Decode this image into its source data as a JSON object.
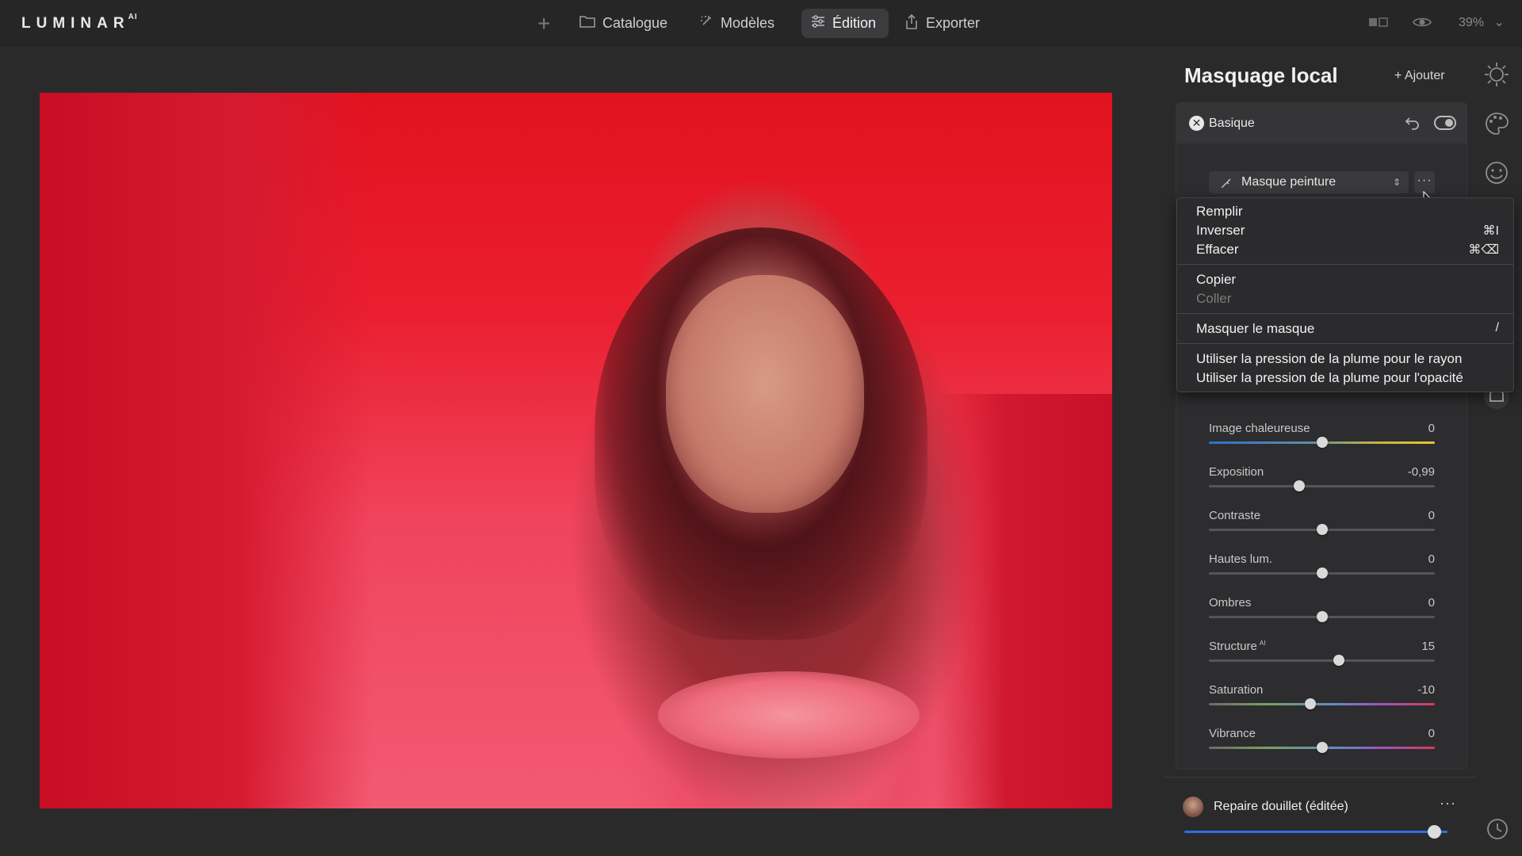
{
  "app": {
    "logo_text": "LUMINAR",
    "logo_suffix": "AI",
    "nav": [
      {
        "label": "Catalogue",
        "icon": "folder-icon"
      },
      {
        "label": "Modèles",
        "icon": "sparkle-icon"
      },
      {
        "label": "Édition",
        "icon": "sliders-icon",
        "active": true
      },
      {
        "label": "Exporter",
        "icon": "share-icon"
      }
    ],
    "add_label": "+",
    "zoom": "39%"
  },
  "panel": {
    "title": "Masquage local",
    "add_label": "+ Ajouter",
    "tool": {
      "name": "Basique",
      "close_glyph": "✕",
      "mask_mode": "Masque peinture",
      "more_glyph": "···"
    },
    "menu": {
      "items": [
        {
          "label": "Remplir",
          "shortcut": "",
          "enabled": true
        },
        {
          "label": "Inverser",
          "shortcut": "⌘I",
          "enabled": true
        },
        {
          "label": "Effacer",
          "shortcut": "⌘⌫",
          "enabled": true
        },
        {
          "label": "Copier",
          "shortcut": "",
          "enabled": true
        },
        {
          "label": "Coller",
          "shortcut": "",
          "enabled": false
        },
        {
          "label": "Masquer le masque",
          "shortcut": "/",
          "enabled": true
        },
        {
          "label": "Utiliser la pression de la plume pour le rayon",
          "shortcut": "",
          "enabled": true
        },
        {
          "label": "Utiliser la pression de la plume pour l'opacité",
          "shortcut": "",
          "enabled": true
        }
      ]
    },
    "sliders": [
      {
        "label": "Image chaleureuse",
        "value": "0",
        "position": 0.5
      },
      {
        "label": "Exposition",
        "value": "-0,99",
        "position": 0.4
      },
      {
        "label": "Contraste",
        "value": "0",
        "position": 0.5
      },
      {
        "label": "Hautes lum.",
        "value": "0",
        "position": 0.5
      },
      {
        "label": "Ombres",
        "value": "0",
        "position": 0.5
      },
      {
        "label": "Structure",
        "label_sup": "AI",
        "value": "15",
        "position": 0.575
      },
      {
        "label": "Saturation",
        "value": "-10",
        "position": 0.45
      },
      {
        "label": "Vibrance",
        "value": "0",
        "position": 0.5
      }
    ]
  },
  "preset": {
    "name": "Repaire douillet (éditée)",
    "more_glyph": "···",
    "amount": 0.95
  },
  "colors": {
    "accent_blue": "#2d6fe0",
    "mask_red": "#e2121f"
  }
}
